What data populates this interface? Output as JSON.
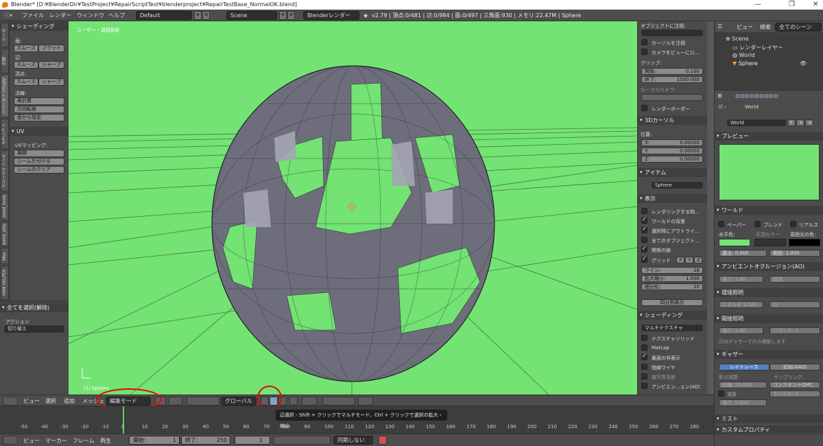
{
  "window": {
    "title": "Blender* [D:¥BlenderDir¥TestProject¥RepairScriptTest¥blenderproject¥RepairTestBase_NormalOK.blend]"
  },
  "info_header": {
    "menus": [
      "ファイル",
      "レンダー",
      "ウィンドウ",
      "ヘルプ"
    ],
    "layout": "Default",
    "scene": "Scene",
    "engine": "Blenderレンダー",
    "stats": "v2.79 | 頂点:0/481 | 辺:0/984 | 面:0/497 | 三角面:930 | メモリ:22.47M | Sphere"
  },
  "left_tabs": [
    "ツール",
    "作成",
    "シェーディング/UV",
    "オプション",
    "グリースペンシル",
    "mmd_tools",
    "mmd_utils",
    "Misc",
    "VRM HELPER"
  ],
  "tool_shelf": {
    "shading_title": "シェーディング",
    "face_label": "面:",
    "edge_label": "辺:",
    "vertex_label": "頂点:",
    "smooth": "スムーズ",
    "flat": "フラット",
    "sharp": "シャープ",
    "normals_label": "法線:",
    "recalc": "再計算",
    "flip": "方向転換",
    "set_from_faces": "面から設定",
    "uv_title": "UV",
    "uv_mapping_label": "UVマッピング:",
    "unwrap": "展開",
    "mark_seam": "シームを付ける",
    "clear_seam": "シームのクリア"
  },
  "operator_panel": {
    "title": "全てを選択(解除)",
    "action_label": "アクション",
    "action_value": "切り替え"
  },
  "viewport": {
    "label": "ユーザー・透視投影",
    "object_name": "(1) Sphere"
  },
  "n_panel": {
    "lock_label": "オブジェクトに注視:",
    "lock_cursor": "カーソルを注視",
    "lock_camera": "カメラをビューにロ...",
    "clip_label": "クリップ:",
    "clip_start_label": "開始:",
    "clip_start": "0.100",
    "clip_end_label": "終了:",
    "clip_end": "1000.000",
    "local_camera_label": "ローカルカメラ:",
    "render_border": "レンダーボーダー",
    "cursor_title": "3Dカーソル",
    "location_label": "位置:",
    "x_label": "X:",
    "x": "0.00000",
    "y_label": "Y:",
    "y": "0.00000",
    "z_label": "Z:",
    "z": "0.00000",
    "item_title": "アイテム",
    "item_name": "Sphere",
    "display_title": "表示",
    "only_render": "レンダリングする物...",
    "world_bg": "ワールドの背景",
    "outline_selected": "選択時にアウトライ...",
    "all_object_origins": "全てのオブジェクト...",
    "relationship_lines": "関係の線",
    "grid_floor": "グリッド",
    "axis_x": "X",
    "axis_y": "Y",
    "axis_z": "Z",
    "lines_label": "ライン:",
    "lines": "16",
    "scale_label": "拡大縮小:",
    "scale": "1.000",
    "subdiv_label": "細分化:",
    "subdiv": "10",
    "quad_view": "四分割表示",
    "shading_title": "シェーディング",
    "shading_mode": "マルチテクスチャ",
    "textured_solid": "テクスチャソリッド",
    "matcap": "Matcap",
    "backface_culling": "裏面の非表示",
    "hidden_wire": "陰線ワイヤ",
    "depth_of_field": "被写界深度",
    "ambient_occlusion": "アンビエン...ョン(AO)"
  },
  "outliner": {
    "view": "ビュー",
    "search": "検索",
    "filter": "全てのシーン",
    "scene": "Scene",
    "render_layers": "レンダーレイヤー",
    "world": "World",
    "sphere": "Sphere"
  },
  "properties": {
    "context": "World",
    "world_name": "World",
    "world_users": "F",
    "preview_title": "プレビュー",
    "world_title": "ワールド",
    "paper": "ペーパー",
    "blend": "ブレンド",
    "real": "リアルス",
    "horizon_label": "水平色:",
    "zenith_label": "天頂カラー",
    "ambient_label": "周囲光の色:",
    "exposure_label": "露出:",
    "exposure": "0.000",
    "range_label": "範囲:",
    "range": "1.000",
    "ao_title": "アンビエントオクルージョン(AO)",
    "ao_strength_label": "強さ:",
    "ao_strength": "1.00",
    "ao_blend": "追加",
    "env_title": "環境照明",
    "env_energy_label": "エネルギ",
    "env_energy": "1.000",
    "env_color": "白",
    "indirect_title": "間接照明",
    "ind_factor_label": "強さ:",
    "ind_factor": "1.00",
    "bounces_label": "バウンス:",
    "bounces": "1",
    "approx_note": "近似ギャザーでのみ機能します",
    "gather_title": "ギャザー",
    "raytrace": "レイトレース",
    "approximate": "近似(AAO)",
    "attenuation_label": "影の減算:",
    "sampling_label": "サンプリング:",
    "distance_label": "距離:",
    "distance": "10.000",
    "qmc": "コンスタントQMC",
    "falloff": "減衰",
    "samples_label": "サンプル:",
    "samples": "5",
    "strength_label": "強さ:",
    "strength": "0.000",
    "mist_title": "ミスト",
    "custom_title": "カスタムプロパティ"
  },
  "viewport_header": {
    "view": "ビュー",
    "select": "選択",
    "add": "追加",
    "mesh": "メッシュ",
    "mode": "編集モード",
    "orientation": "グローバル"
  },
  "tooltip": "辺選択 - Shift + クリックでマルチモード、Ctrl + クリックで選択の拡大・縮小",
  "timeline": {
    "ticks": [
      "-50",
      "-40",
      "-30",
      "-20",
      "-10",
      "0",
      "10",
      "20",
      "30",
      "40",
      "50",
      "60",
      "70",
      "80",
      "90",
      "100",
      "110",
      "120",
      "130",
      "140",
      "150",
      "160",
      "170",
      "180",
      "190",
      "200",
      "210",
      "220",
      "230",
      "240",
      "250",
      "260",
      "270",
      "280"
    ],
    "view": "ビュー",
    "marker": "マーカー",
    "frame": "フレーム",
    "playback": "再生",
    "start_label": "開始:",
    "start": "1",
    "end_label": "終了:",
    "end": "250",
    "current": "1",
    "sync": "同期しない"
  },
  "colors": {
    "viewport_bg": "#73e373",
    "sphere_face": "#6e6e7e",
    "selected_face": "#9c9cab",
    "annotation": "#e00000"
  }
}
